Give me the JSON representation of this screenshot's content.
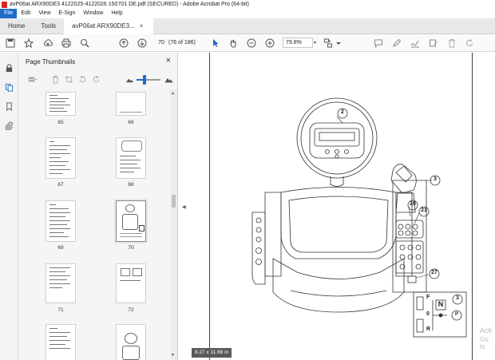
{
  "window": {
    "title": "avP06at ARX90DE3 4122025-4122026 150701 DE.pdf (SECURED) - Adobe Acrobat Pro (64-bit)"
  },
  "menu": {
    "items": [
      "File",
      "Edit",
      "View",
      "E-Sign",
      "Window",
      "Help"
    ]
  },
  "tabs": {
    "home": "Home",
    "tools": "Tools",
    "document": "avP06at ARX90DE3...",
    "close": "×"
  },
  "toolbar": {
    "page_number": "70",
    "page_count": "(76 of 186)",
    "zoom": "79.8%",
    "zoom_dropdown": "▾"
  },
  "thumbnails": {
    "title": "Page Thumbnails",
    "close": "×",
    "pages": [
      {
        "label": "65"
      },
      {
        "label": "66"
      },
      {
        "label": "67"
      },
      {
        "label": "68"
      },
      {
        "label": "69"
      },
      {
        "label": "70"
      },
      {
        "label": "71"
      },
      {
        "label": "72"
      }
    ],
    "selected_page": "70"
  },
  "diagram": {
    "callouts": [
      "2",
      "3",
      "20",
      "21",
      "27"
    ],
    "inset": {
      "gear_N": "N",
      "gear_F": "F",
      "gear_R": "R",
      "zero": "0",
      "callout": "3",
      "button": "P"
    }
  },
  "status": {
    "page_size": "8.27 x 11.69 in"
  },
  "watermark": {
    "line1": "Acti",
    "line2": "Go to"
  },
  "colors": {
    "accent": "#1e6bc7",
    "brand_red": "#d4271d"
  }
}
